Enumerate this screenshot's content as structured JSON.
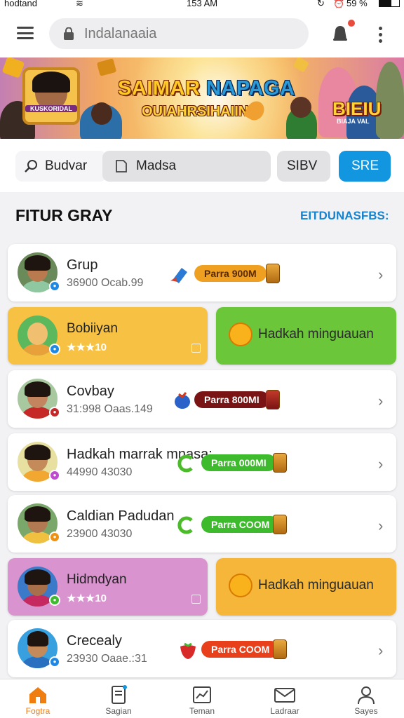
{
  "status_bar": {
    "carrier": "hodtand",
    "time": "153 AM",
    "battery": "59 %"
  },
  "header": {
    "search_text": "Indalanaaia"
  },
  "banner": {
    "title_part1": "SAIMAR",
    "title_part2": "NAPAGA",
    "subtitle": "OUIAHRSIHAIIN",
    "frame_label": "KUSKORIDAL",
    "right_badge": "BIEIU",
    "right_badge_sub": "BIAJA VAL"
  },
  "filters": {
    "chip1": "Budvar",
    "chip2": "Madsa",
    "chip3": "SIBV",
    "chip4": "SRE"
  },
  "section": {
    "title": "FITUR GRAY",
    "link": "EITDUNASFBS:"
  },
  "list": [
    {
      "name": "Grup",
      "sub": "36900 Ocab.99",
      "pill": "Parra 900M",
      "pill_color": "#f0a020",
      "badge_color": "#1e88e5",
      "icon": "blue-gem-icon"
    },
    {
      "name": "Covbay",
      "sub": "31:998 Oaas.149",
      "pill": "Parra 800MI",
      "pill_color": "#7a1414",
      "badge_color": "#c62828",
      "icon": "berry-icon"
    },
    {
      "name": "Hadkah marrak mnasa:",
      "sub": "44990 43030",
      "pill": "Parra 000MI",
      "pill_color": "#3dbb2d",
      "badge_color": "#c04ad0",
      "icon": "green-swirl-icon"
    },
    {
      "name": "Caldian Padudan",
      "sub": "23900 43030",
      "pill": "Parra COOM",
      "pill_color": "#3dbb2d",
      "badge_color": "#f09010",
      "icon": "green-swirl-icon"
    },
    {
      "name": "Crecealy",
      "sub": "23930 Oaae.:31",
      "pill": "Parra COOM",
      "pill_color": "#e8401a",
      "badge_color": "#1e88e5",
      "icon": "strawberry-icon"
    }
  ],
  "promo_rows": [
    {
      "name": "Bobiiyan",
      "rating": "★★★10",
      "cta": "Hadkah minguauan",
      "left_color": "#f7c244",
      "right_color": "#6cc63a"
    },
    {
      "name": "Hidmdyan",
      "rating": "★★★10",
      "cta": "Hadkah minguauan",
      "left_color": "#d993cf",
      "right_color": "#f5b63a"
    }
  ],
  "bottom_nav": [
    {
      "label": "Fogtra",
      "icon": "home-icon",
      "active": true
    },
    {
      "label": "Sagian",
      "icon": "document-icon",
      "active": false
    },
    {
      "label": "Teman",
      "icon": "chart-icon",
      "active": false
    },
    {
      "label": "Ladraar",
      "icon": "mail-icon",
      "active": false
    },
    {
      "label": "Sayes",
      "icon": "user-icon",
      "active": false
    }
  ],
  "colors": {
    "accent": "#1296e0",
    "active_nav": "#f07d10"
  }
}
